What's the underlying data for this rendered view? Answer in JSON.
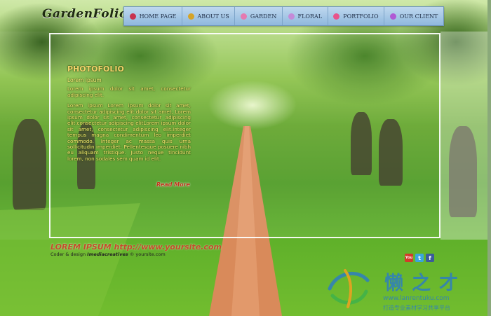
{
  "brand": {
    "logo_text": "GardenFolio"
  },
  "nav": {
    "items": [
      {
        "label": "HOME PAGE",
        "icon": "red-flower-icon",
        "color": "#c8324f"
      },
      {
        "label": "ABOUT US",
        "icon": "yellow-flower-icon",
        "color": "#d6a428"
      },
      {
        "label": "GARDEN",
        "icon": "pink-flower-icon",
        "color": "#e57ab0"
      },
      {
        "label": "FLORAL",
        "icon": "lilac-flower-icon",
        "color": "#c58ad8"
      },
      {
        "label": "PORTFOLIO",
        "icon": "rose-flower-icon",
        "color": "#e8548b"
      },
      {
        "label": "OUR CLIENT",
        "icon": "violet-flower-icon",
        "color": "#b05ad4"
      }
    ]
  },
  "content": {
    "title": "PHOTOFOLIO",
    "subtitle": "Lorem ipsum",
    "paragraph_1": "Lorem ipsum dolor sit amet, consectetur adipiscing elit.",
    "paragraph_2": "Lorem ipsum Lorem ipsum dolor sit amet, consectetur adipiscing elit.dolor sit amet, Lorem ipsum dolor sit amet, consectetur adipiscing elit.consectetur adipiscing elitLorem ipsum dolor sit amet, consectetur adipiscing elit.Integer tempus magna condimentum leo imperdiet commodo. Integer ac massa quis urna sollicitudin imperdiet. Pellentesque posuere nibh eu aliquam tristique. Justo neque tincidunt lorem, non sodales sem quam id elit.",
    "read_more": "Read More"
  },
  "footer": {
    "title": "LOREM IPSUM http://www.yoursite.com",
    "credit_prefix": "Coder & design",
    "credit_brand": "Imediacreatives",
    "credit_suffix": "© yoursite.com"
  },
  "social": [
    {
      "label": "You",
      "icon": "youtube-icon",
      "color": "#d23a2a"
    },
    {
      "label": "t",
      "icon": "twitter-icon",
      "color": "#3aa6dd"
    },
    {
      "label": "f",
      "icon": "facebook-icon",
      "color": "#3b5b9b"
    }
  ],
  "watermark": {
    "chinese": "懒之才",
    "url": "www.lanrentuku.com",
    "line": "打造专业素材学习共享平台"
  }
}
